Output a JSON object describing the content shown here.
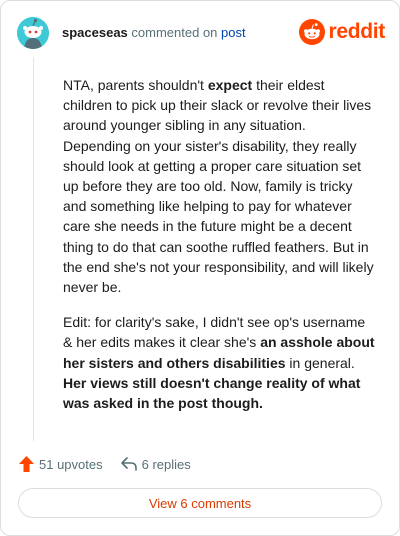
{
  "header": {
    "username": "spaceseas",
    "action": "commented on",
    "post_link": "post",
    "brand": "reddit"
  },
  "comment": {
    "paragraph1": "NTA, parents shouldn't expect their eldest children to pick up their slack or revolve their lives around younger sibling in any situation. Depending on your sister's disability, they really should look at getting a proper care situation set up before they are too old. Now, family is tricky and something like helping to pay for whatever care she needs in the future might be a decent thing to do that can soothe ruffled feathers. But in the end she's not your responsibility, and will likely never be.",
    "paragraph1_parts": {
      "before": "NTA, parents shouldn't ",
      "bold": "expect",
      "after": " their eldest children to pick up their slack or revolve their lives around younger sibling in any situation. Depending on your sister's disability, they really should look at getting a proper care situation set up before they are too old. Now, family is tricky and something like helping to pay for whatever care she needs in the future might be a decent thing to do that can soothe ruffled feathers. But in the end she's not your responsibility, and will likely never be."
    },
    "paragraph2_parts": {
      "before": "Edit: for clarity's sake, I didn't see op's username & her edits makes it clear she's ",
      "bold1": "an asshole about her sisters and others disabilities",
      "middle": " in general. ",
      "bold2": "Her views still doesn't change reality of what was asked in the post though."
    }
  },
  "actions": {
    "upvotes": "51 upvotes",
    "replies": "6 replies"
  },
  "view_button": "View 6 comments",
  "colors": {
    "accent": "#ff4500",
    "link": "#0045ac",
    "meta": "#576f76",
    "avatar_bg": "#3ec9d6"
  },
  "icons": [
    "snoo-avatar-icon",
    "reddit-logo-icon",
    "upvote-arrow-icon",
    "reply-arrow-icon"
  ]
}
